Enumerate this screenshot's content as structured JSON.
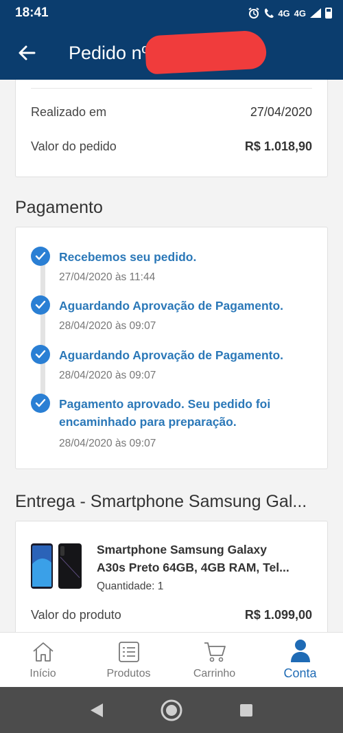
{
  "status_bar": {
    "time": "18:41",
    "network": "4G",
    "network2": "4G"
  },
  "app_bar": {
    "title": "Pedido nº"
  },
  "summary": {
    "order_date_label": "Realizado em",
    "order_date_value": "27/04/2020",
    "order_value_label": "Valor do pedido",
    "order_value_value": "R$ 1.018,90"
  },
  "payment": {
    "title": "Pagamento",
    "steps": [
      {
        "status": "Recebemos seu pedido.",
        "date": "27/04/2020 às 11:44"
      },
      {
        "status": "Aguardando Aprovação de Pagamento.",
        "date": "28/04/2020 às 09:07"
      },
      {
        "status": "Aguardando Aprovação de Pagamento.",
        "date": "28/04/2020 às 09:07"
      },
      {
        "status_line1": "Pagamento aprovado. Seu pedido foi",
        "status_line2": "encaminhado para preparação.",
        "date": "28/04/2020 às 09:07"
      }
    ]
  },
  "delivery": {
    "title": "Entrega - Smartphone Samsung Gal...",
    "product_line1": "Smartphone Samsung Galaxy",
    "product_line2": "A30s Preto 64GB, 4GB RAM, Tel...",
    "quantity": "Quantidade: 1",
    "product_value_label": "Valor do produto",
    "product_value_value": "R$ 1.099,00"
  },
  "bottom_nav": {
    "items": [
      {
        "label": "Início",
        "icon": "home-icon"
      },
      {
        "label": "Produtos",
        "icon": "list-icon"
      },
      {
        "label": "Carrinho",
        "icon": "cart-icon"
      },
      {
        "label": "Conta",
        "icon": "user-icon",
        "active": true
      }
    ]
  },
  "colors": {
    "header": "#0b3d6e",
    "accent": "#2b78b8",
    "active_tab": "#1f6bb5"
  }
}
